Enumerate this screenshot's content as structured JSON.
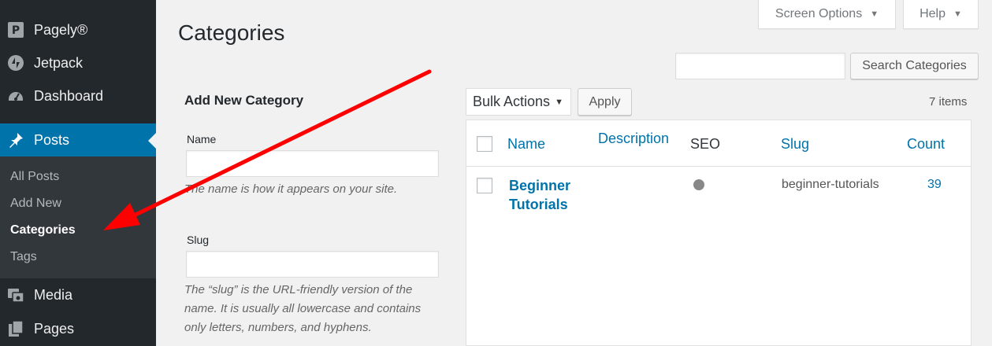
{
  "sidebar": {
    "items": [
      {
        "label": "Pagely®",
        "icon": "pagely-icon"
      },
      {
        "label": "Jetpack",
        "icon": "jetpack-icon"
      },
      {
        "label": "Dashboard",
        "icon": "dashboard-icon"
      },
      {
        "label": "Posts",
        "icon": "pin-icon"
      },
      {
        "label": "Media",
        "icon": "media-icon"
      },
      {
        "label": "Pages",
        "icon": "pages-icon"
      }
    ],
    "submenu": [
      "All Posts",
      "Add New",
      "Categories",
      "Tags"
    ]
  },
  "header": {
    "screen_options": "Screen Options",
    "help": "Help",
    "title": "Categories"
  },
  "search": {
    "placeholder": "",
    "button": "Search Categories"
  },
  "form": {
    "title": "Add New Category",
    "name_label": "Name",
    "name_value": "",
    "name_hint": "The name is how it appears on your site.",
    "slug_label": "Slug",
    "slug_value": "",
    "slug_hint": "The “slug” is the URL-friendly version of the name. It is usually all lowercase and contains only letters, numbers, and hyphens."
  },
  "table": {
    "bulk_actions": "Bulk Actions",
    "apply": "Apply",
    "items_count": "7 items",
    "columns": {
      "name": "Name",
      "description": "Description",
      "seo": "SEO",
      "slug": "Slug",
      "count": "Count"
    },
    "rows": [
      {
        "name": "Beginner Tutorials",
        "description": "",
        "slug": "beginner-tutorials",
        "count": "39"
      }
    ]
  },
  "colors": {
    "sidebar_bg": "#23282d",
    "active_bg": "#0073aa",
    "link": "#0073aa",
    "arrow": "#ff0000"
  }
}
